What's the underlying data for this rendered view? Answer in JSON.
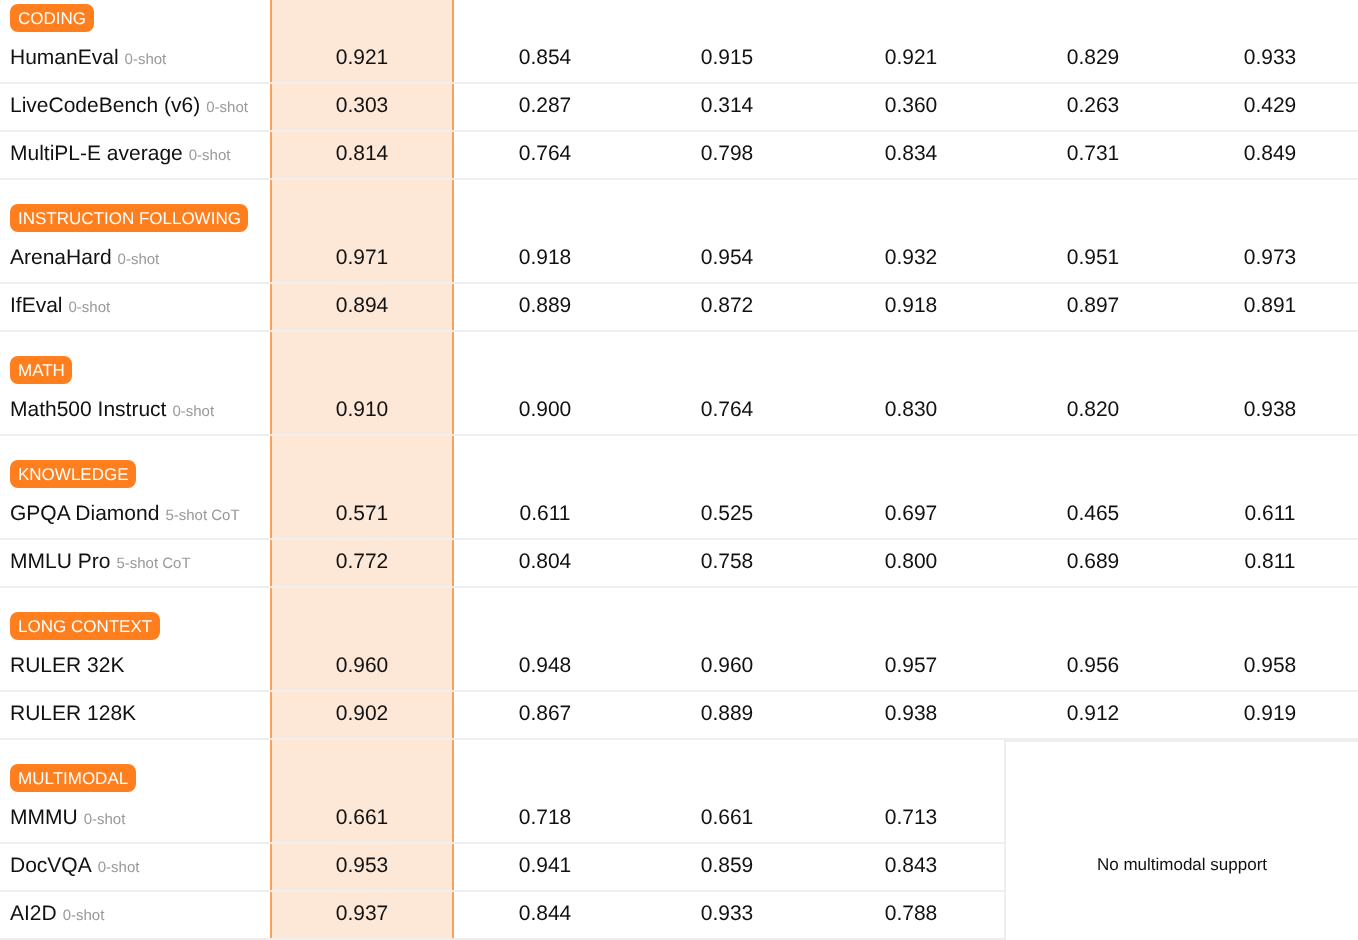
{
  "sections": [
    {
      "title": "CODING",
      "rows": [
        {
          "benchmark": "HumanEval",
          "setting": "0-shot",
          "values": [
            "0.921",
            "0.854",
            "0.915",
            "0.921",
            "0.829",
            "0.933"
          ]
        },
        {
          "benchmark": "LiveCodeBench (v6)",
          "setting": "0-shot",
          "values": [
            "0.303",
            "0.287",
            "0.314",
            "0.360",
            "0.263",
            "0.429"
          ]
        },
        {
          "benchmark": "MultiPL-E average",
          "setting": "0-shot",
          "values": [
            "0.814",
            "0.764",
            "0.798",
            "0.834",
            "0.731",
            "0.849"
          ]
        }
      ]
    },
    {
      "title": "INSTRUCTION FOLLOWING",
      "rows": [
        {
          "benchmark": "ArenaHard",
          "setting": "0-shot",
          "values": [
            "0.971",
            "0.918",
            "0.954",
            "0.932",
            "0.951",
            "0.973"
          ]
        },
        {
          "benchmark": "IfEval",
          "setting": "0-shot",
          "values": [
            "0.894",
            "0.889",
            "0.872",
            "0.918",
            "0.897",
            "0.891"
          ]
        }
      ]
    },
    {
      "title": "MATH",
      "rows": [
        {
          "benchmark": "Math500 Instruct",
          "setting": "0-shot",
          "values": [
            "0.910",
            "0.900",
            "0.764",
            "0.830",
            "0.820",
            "0.938"
          ]
        }
      ]
    },
    {
      "title": "KNOWLEDGE",
      "rows": [
        {
          "benchmark": "GPQA Diamond",
          "setting": "5-shot CoT",
          "values": [
            "0.571",
            "0.611",
            "0.525",
            "0.697",
            "0.465",
            "0.611"
          ]
        },
        {
          "benchmark": "MMLU Pro",
          "setting": "5-shot CoT",
          "values": [
            "0.772",
            "0.804",
            "0.758",
            "0.800",
            "0.689",
            "0.811"
          ]
        }
      ]
    },
    {
      "title": "LONG CONTEXT",
      "rows": [
        {
          "benchmark": "RULER 32K",
          "values": [
            "0.960",
            "0.948",
            "0.960",
            "0.957",
            "0.956",
            "0.958"
          ]
        },
        {
          "benchmark": "RULER 128K",
          "values": [
            "0.902",
            "0.867",
            "0.889",
            "0.938",
            "0.912",
            "0.919"
          ]
        }
      ]
    },
    {
      "title": "MULTIMODAL",
      "note": "No multimodal support",
      "rows": [
        {
          "benchmark": "MMMU",
          "setting": "0-shot",
          "values": [
            "0.661",
            "0.718",
            "0.661",
            "0.713"
          ]
        },
        {
          "benchmark": "DocVQA",
          "setting": "0-shot",
          "values": [
            "0.953",
            "0.941",
            "0.859",
            "0.843"
          ]
        },
        {
          "benchmark": "AI2D",
          "setting": "0-shot",
          "values": [
            "0.937",
            "0.844",
            "0.933",
            "0.788"
          ]
        }
      ]
    }
  ]
}
